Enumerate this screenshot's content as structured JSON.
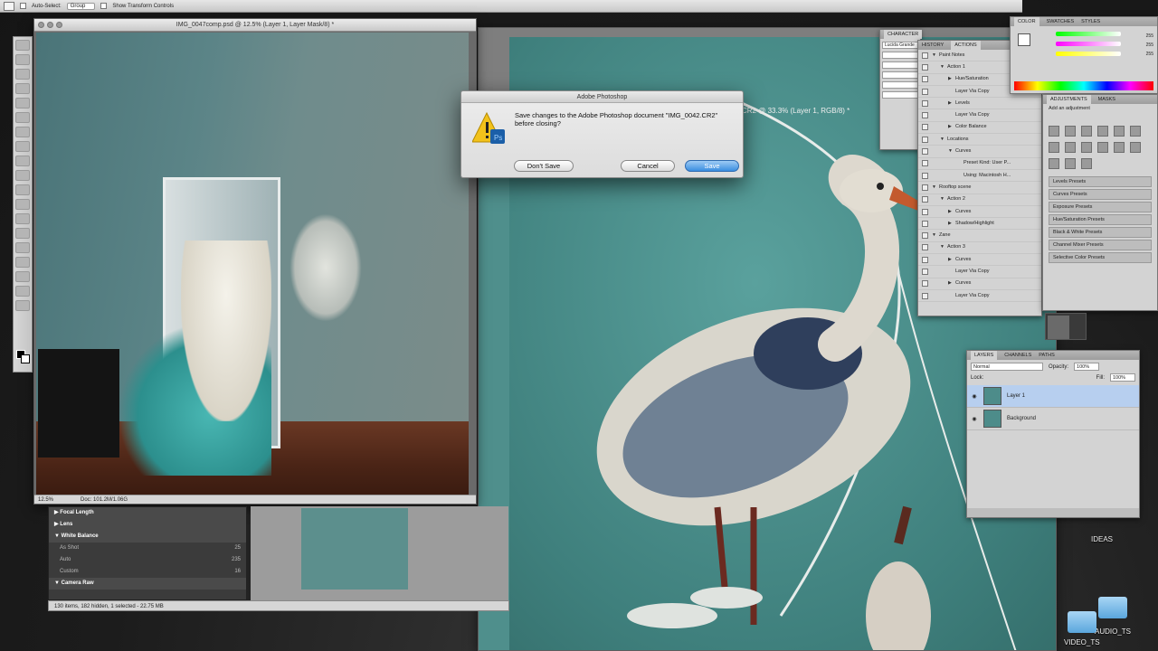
{
  "options_bar": {
    "auto_select_label": "Auto-Select:",
    "auto_select_value": "Group",
    "transform_label": "Show Transform Controls"
  },
  "doc_left": {
    "title": "IMG_0047comp.psd @ 12.5% (Layer 1, Layer Mask/8) *",
    "zoom": "12.5%",
    "doc_info": "Doc: 101.2M/1.06G"
  },
  "doc_right": {
    "title": "CR2 @ 33.3% (Layer 1, RGB/8) *"
  },
  "dialog": {
    "title": "Adobe Photoshop",
    "message": "Save changes to the Adobe Photoshop document \"IMG_0042.CR2\" before closing?",
    "dont_save": "Don't Save",
    "cancel": "Cancel",
    "save": "Save"
  },
  "bridge": {
    "rows": [
      {
        "label": "Focal Length",
        "value": "",
        "kind": "hdr-closed"
      },
      {
        "label": "Lens",
        "value": "",
        "kind": "hdr-closed"
      },
      {
        "label": "White Balance",
        "value": "",
        "kind": "hdr"
      },
      {
        "label": "As Shot",
        "value": "25",
        "kind": "sub"
      },
      {
        "label": "Auto",
        "value": "235",
        "kind": "sub"
      },
      {
        "label": "Custom",
        "value": "16",
        "kind": "sub"
      },
      {
        "label": "Camera Raw",
        "value": "",
        "kind": "hdr"
      }
    ],
    "footer": "130 items, 182 hidden, 1 selected - 22.75 MB"
  },
  "character_panel": {
    "tab": "CHARACTER",
    "font": "Lucida Grande"
  },
  "history_panel": {
    "tabs": [
      "HISTORY",
      "ACTIONS"
    ],
    "items": [
      {
        "label": "Paint Notes",
        "indent": 0,
        "tri": "▼"
      },
      {
        "label": "Action 1",
        "indent": 1,
        "tri": "▼"
      },
      {
        "label": "Hue/Saturation",
        "indent": 2,
        "tri": "▶"
      },
      {
        "label": "Layer Via Copy",
        "indent": 2,
        "tri": ""
      },
      {
        "label": "Levels",
        "indent": 2,
        "tri": "▶"
      },
      {
        "label": "Layer Via Copy",
        "indent": 2,
        "tri": ""
      },
      {
        "label": "Color Balance",
        "indent": 2,
        "tri": "▶"
      },
      {
        "label": "Locations",
        "indent": 1,
        "tri": "▼"
      },
      {
        "label": "Curves",
        "indent": 2,
        "tri": "▼"
      },
      {
        "label": "Preset Kind: User P...",
        "indent": 3,
        "tri": ""
      },
      {
        "label": "Using: Macintosh H...",
        "indent": 3,
        "tri": ""
      },
      {
        "label": "Rooftop scene",
        "indent": 0,
        "tri": "▼"
      },
      {
        "label": "Action 2",
        "indent": 1,
        "tri": "▼"
      },
      {
        "label": "Curves",
        "indent": 2,
        "tri": "▶"
      },
      {
        "label": "Shadow/Highlight",
        "indent": 2,
        "tri": "▶"
      },
      {
        "label": "Zane",
        "indent": 0,
        "tri": "▼"
      },
      {
        "label": "Action 3",
        "indent": 1,
        "tri": "▼"
      },
      {
        "label": "Curves",
        "indent": 2,
        "tri": "▶"
      },
      {
        "label": "Layer Via Copy",
        "indent": 2,
        "tri": ""
      },
      {
        "label": "Curves",
        "indent": 2,
        "tri": "▶"
      },
      {
        "label": "Layer Via Copy",
        "indent": 2,
        "tri": ""
      }
    ]
  },
  "color_panel": {
    "tabs": [
      "COLOR",
      "SWATCHES",
      "STYLES"
    ],
    "r": "255",
    "g": "255",
    "b": "255"
  },
  "adjustments_panel": {
    "tabs": [
      "ADJUSTMENTS",
      "MASKS"
    ],
    "caption": "Add an adjustment",
    "presets": [
      "Levels Presets",
      "Curves Presets",
      "Exposure Presets",
      "Hue/Saturation Presets",
      "Black & White Presets",
      "Channel Mixer Presets",
      "Selective Color Presets"
    ]
  },
  "layers_panel": {
    "tabs": [
      "LAYERS",
      "CHANNELS",
      "PATHS"
    ],
    "blend_mode": "Normal",
    "opacity_label": "Opacity:",
    "opacity": "100%",
    "lock_label": "Lock:",
    "fill_label": "Fill:",
    "fill": "100%",
    "layers": [
      {
        "name": "Layer 1",
        "active": true
      },
      {
        "name": "Background",
        "active": false
      }
    ]
  },
  "desktop": {
    "folders": [
      "IDEAS",
      "AUDIO_TS",
      "VIDEO_TS"
    ]
  }
}
